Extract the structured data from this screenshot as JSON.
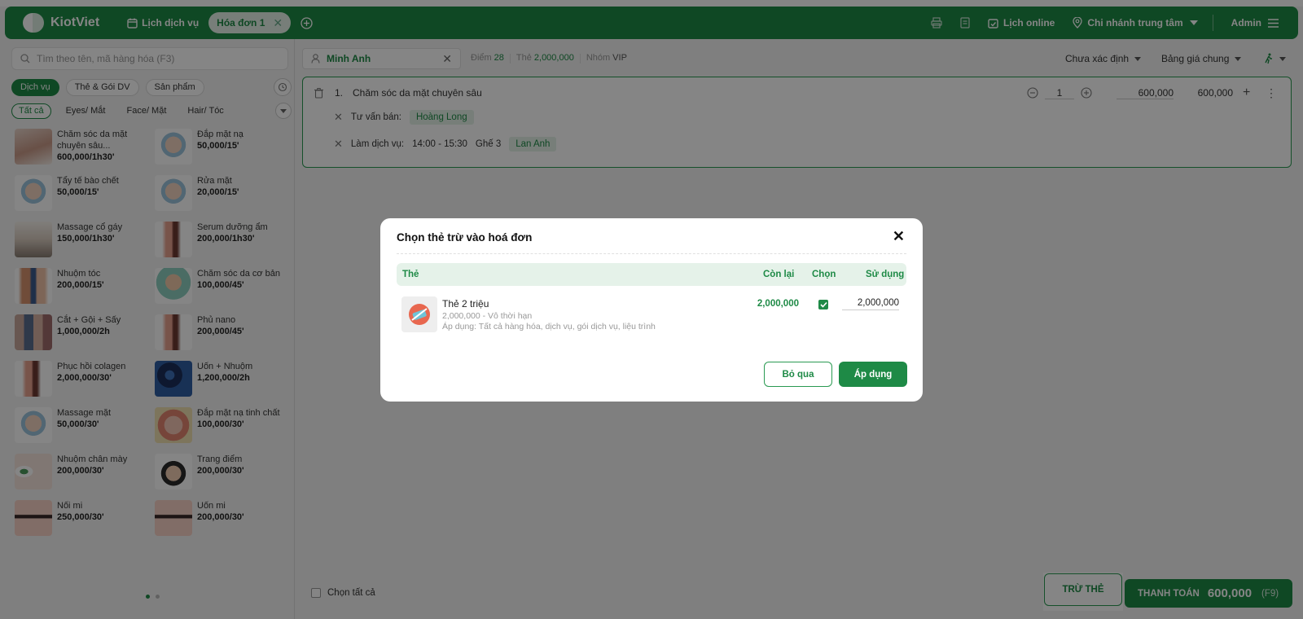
{
  "app": {
    "brand": "KiotViet",
    "nav_schedule": "Lịch dịch vụ",
    "active_tab": "Hóa đơn 1",
    "online_schedule": "Lịch online",
    "branch": "Chi nhánh trung tâm",
    "user": "Admin",
    "brand_color": "#1e8a46"
  },
  "left": {
    "search_placeholder": "Tìm theo tên, mã hàng hóa (F3)",
    "categories": [
      "Dịch vụ",
      "Thẻ & Gói DV",
      "Sản phẩm"
    ],
    "subcategories": [
      "Tất cả",
      "Eyes/ Mắt",
      "Face/ Mặt",
      "Hair/ Tóc"
    ],
    "products": [
      {
        "name": "Chăm sóc da mặt chuyên sâu...",
        "price": "600,000/1h30'"
      },
      {
        "name": "Đắp mặt nạ",
        "price": "50,000/15'"
      },
      {
        "name": "Tẩy tế bào chết",
        "price": "50,000/15'"
      },
      {
        "name": "Rửa mặt",
        "price": "20,000/15'"
      },
      {
        "name": "Massage cổ gáy",
        "price": "150,000/1h30'"
      },
      {
        "name": "Serum dưỡng ẩm",
        "price": "200,000/1h30'"
      },
      {
        "name": "Nhuộm tóc",
        "price": "200,000/15'"
      },
      {
        "name": "Chăm sóc da cơ bản",
        "price": "100,000/45'"
      },
      {
        "name": "Cắt + Gội + Sấy",
        "price": "1,000,000/2h"
      },
      {
        "name": "Phủ nano",
        "price": "200,000/45'"
      },
      {
        "name": "Phục hồi colagen",
        "price": "2,000,000/30'"
      },
      {
        "name": "Uốn + Nhuộm",
        "price": "1,200,000/2h"
      },
      {
        "name": "Massage mặt",
        "price": "50,000/30'"
      },
      {
        "name": "Đắp mặt nạ tinh chất",
        "price": "100,000/30'"
      },
      {
        "name": "Nhuộm chân mày",
        "price": "200,000/30'"
      },
      {
        "name": "Trang điểm",
        "price": "200,000/30'"
      },
      {
        "name": "Nối mi",
        "price": "250,000/30'"
      },
      {
        "name": "Uốn mi",
        "price": "200,000/30'"
      }
    ]
  },
  "customer": {
    "name": "Minh Anh",
    "points_label": "Điểm",
    "points": "28",
    "card_label": "Thẻ",
    "card": "2,000,000",
    "group_label": "Nhóm",
    "group": "VIP",
    "status": "Chưa xác định",
    "pricebook": "Bảng giá chung"
  },
  "line": {
    "index": "1.",
    "name": "Chăm sóc da mặt chuyên sâu",
    "qty": "1",
    "unit_price": "600,000",
    "total": "600,000",
    "consultant_label": "Tư vấn bán:",
    "consultant": "Hoàng Long",
    "service_label": "Làm dịch vụ:",
    "time": "14:00 - 15:30",
    "seat": "Ghế 3",
    "staff": "Lan Anh"
  },
  "footer": {
    "select_all": "Chọn tất cả",
    "card_button": "TRỪ THẺ",
    "pay_label": "THANH TOÁN",
    "pay_amount": "600,000",
    "pay_key": "(F9)"
  },
  "modal": {
    "title": "Chọn thẻ trừ vào hoá đơn",
    "col_card": "Thẻ",
    "col_remaining": "Còn lại",
    "col_select": "Chọn",
    "col_use": "Sử dụng",
    "card_name": "Thẻ 2 triệu",
    "card_desc": "2,000,000 - Vô thời hạn",
    "card_apply": "Áp dụng: Tất cả hàng hóa, dịch vụ, gói dịch vụ, liệu trình",
    "remaining": "2,000,000",
    "selected": true,
    "use_amount": "2,000,000",
    "skip": "Bỏ qua",
    "apply": "Áp dụng"
  }
}
